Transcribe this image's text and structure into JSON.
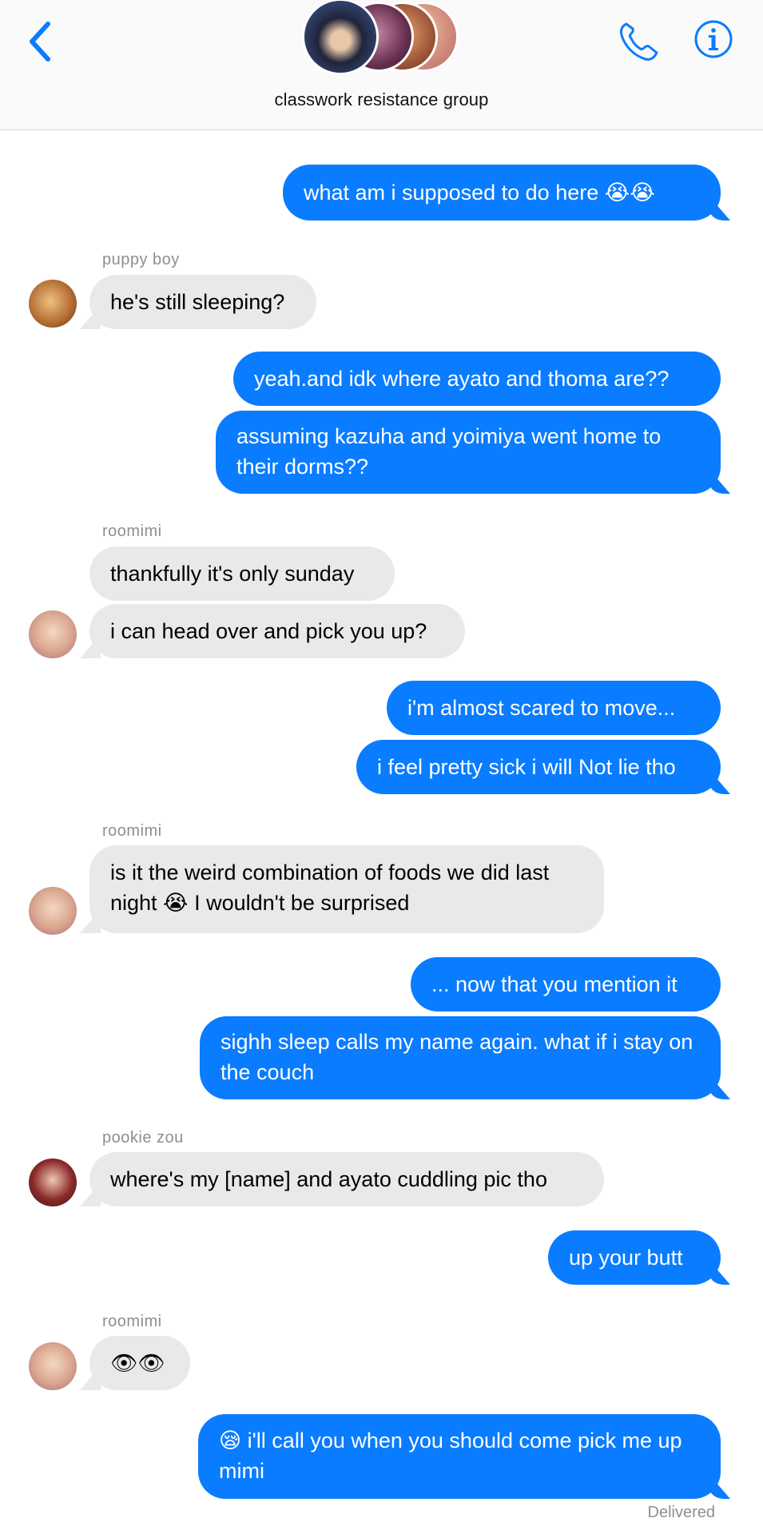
{
  "header": {
    "title": "classwork resistance group",
    "back_icon": "chevron-left-icon",
    "call_icon": "phone-icon",
    "info_icon": "info-icon",
    "accent": "#0a7cff"
  },
  "messages": [
    {
      "type": "out",
      "text": "what am i supposed to do here 😭😭"
    },
    {
      "type": "sender",
      "text": "puppy boy"
    },
    {
      "type": "in",
      "text": "he's still sleeping?"
    },
    {
      "type": "out",
      "text": "yeah.and idk where ayato and thoma are??"
    },
    {
      "type": "out",
      "text": "assuming kazuha and yoimiya went home to their dorms??"
    },
    {
      "type": "sender",
      "text": "roomimi"
    },
    {
      "type": "in",
      "text": "thankfully it's only sunday"
    },
    {
      "type": "in",
      "text": "i can head over and pick you up?"
    },
    {
      "type": "out",
      "text": "i'm almost scared to move..."
    },
    {
      "type": "out",
      "text": "i feel pretty sick i will Not lie tho"
    },
    {
      "type": "sender",
      "text": "roomimi"
    },
    {
      "type": "in",
      "text": "is it the weird combination of foods we did last night 😭 I wouldn't be surprised"
    },
    {
      "type": "out",
      "text": "... now that you mention it"
    },
    {
      "type": "out",
      "text": "sighh sleep calls my name again. what if i stay on the couch"
    },
    {
      "type": "sender",
      "text": "pookie zou"
    },
    {
      "type": "in",
      "text": "where's my [name] and ayato cuddling pic tho"
    },
    {
      "type": "out",
      "text": "up your butt"
    },
    {
      "type": "sender",
      "text": "roomimi"
    },
    {
      "type": "in",
      "text": "👁👁"
    },
    {
      "type": "out",
      "text": "😪 i'll call you when you should come pick me up mimi"
    }
  ],
  "status": "Delivered",
  "colors": {
    "outgoing": "#0a7cff",
    "incoming": "#e9e9eb",
    "sender_label": "#8e8e93"
  }
}
